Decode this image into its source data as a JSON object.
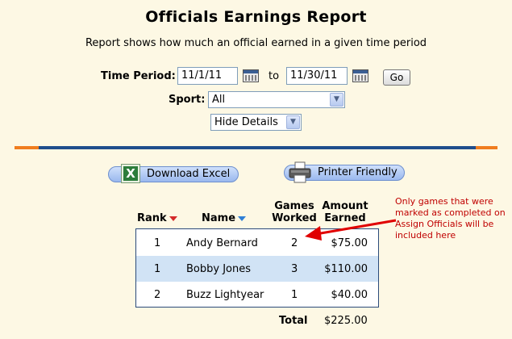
{
  "header": {
    "title": "Officials Earnings Report",
    "subtitle": "Report shows how much an official earned in a given time period"
  },
  "filters": {
    "time_period_label": "Time Period:",
    "start_date": "11/1/11",
    "to_label": "to",
    "end_date": "11/30/11",
    "go_label": "Go",
    "sport_label": "Sport:",
    "sport_value": "All",
    "details_value": "Hide Details"
  },
  "actions": {
    "download_excel": "Download Excel",
    "printer_friendly": "Printer Friendly"
  },
  "table": {
    "columns": {
      "rank": "Rank",
      "name": "Name",
      "games_worked": [
        "Games",
        "Worked"
      ],
      "amount_earned": [
        "Amount",
        "Earned"
      ]
    },
    "rows": [
      {
        "rank": "1",
        "name": "Andy Bernard",
        "games": "2",
        "amount": "$75.00"
      },
      {
        "rank": "1",
        "name": "Bobby Jones",
        "games": "3",
        "amount": "$110.00"
      },
      {
        "rank": "2",
        "name": "Buzz Lightyear",
        "games": "1",
        "amount": "$40.00"
      }
    ],
    "total_label": "Total",
    "total_value": "$225.00"
  },
  "annotation": {
    "text": "Only games that were marked as completed on Assign Officials will be included here"
  },
  "colors": {
    "background": "#fdf8e4",
    "rule_blue": "#1f4e8c",
    "rule_orange": "#f07d1e",
    "alt_row": "#d1e3f5",
    "annotation_red": "#c00000",
    "sort_down_red": "#d42a2a",
    "sort_down_blue": "#2f7fd6"
  },
  "icons": {
    "calendar": "calendar-icon",
    "excel": "excel-icon",
    "printer": "printer-icon",
    "sort_rank": "sort-desc-red-icon",
    "sort_name": "sort-desc-blue-icon",
    "annotation_arrow": "arrow-left-icon"
  }
}
